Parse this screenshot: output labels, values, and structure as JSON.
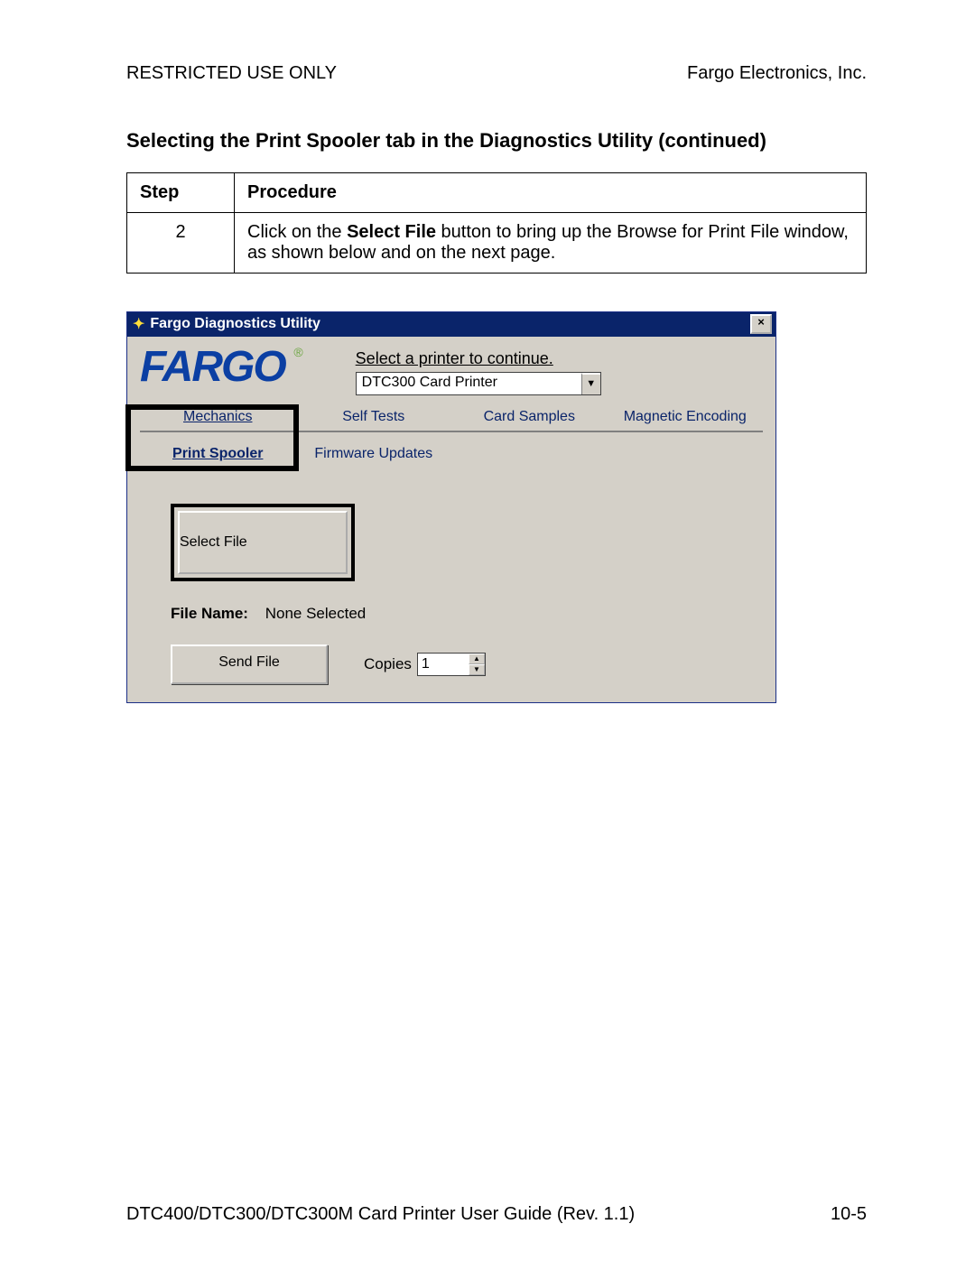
{
  "doc": {
    "header_left": "RESTRICTED USE ONLY",
    "header_right": "Fargo Electronics, Inc.",
    "section_title": "Selecting the Print Spooler tab in the Diagnostics Utility (continued)",
    "table": {
      "col_step": "Step",
      "col_procedure": "Procedure",
      "step_num": "2",
      "proc_pre": "Click on the ",
      "proc_bold": "Select File",
      "proc_post": " button to bring up the Browse for Print File window, as shown below and on the next page."
    },
    "footer_left": "DTC400/DTC300/DTC300M Card Printer User Guide (Rev. 1.1)",
    "footer_right": "10-5"
  },
  "win": {
    "title": "Fargo Diagnostics Utility",
    "logo_text": "FARGO",
    "logo_reg": "®",
    "prompt": "Select a printer to continue.",
    "combo_value": "DTC300 Card Printer",
    "tabs": {
      "mechanics": "Mechanics",
      "self_tests": "Self Tests",
      "card_samples": "Card Samples",
      "magnetic": "Magnetic Encoding",
      "print_spooler": "Print Spooler",
      "firmware": "Firmware Updates"
    },
    "select_file_btn": "Select File",
    "file_name_label": "File Name:",
    "file_name_value": "None Selected",
    "send_file_btn": "Send File",
    "copies_label": "Copies",
    "copies_value": "1"
  }
}
